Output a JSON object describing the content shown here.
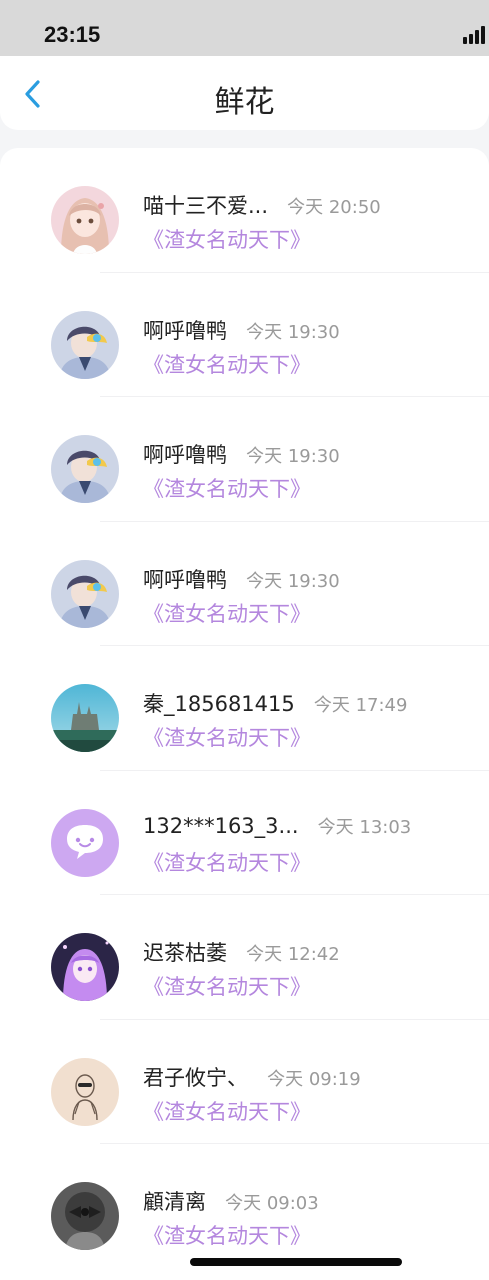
{
  "status_bar": {
    "time": "23:15",
    "signal_icon": "signal-bars-icon"
  },
  "header": {
    "title": "鲜花",
    "back_icon": "chevron-left-icon"
  },
  "colors": {
    "accent": "#b487de",
    "back_arrow": "#2a9de0",
    "timestamp": "#9a9a9a"
  },
  "items": [
    {
      "username": "喵十三不爱...",
      "time": "今天 20:50",
      "book": "《渣女名动天下》",
      "avatar": "anime-girl-avatar"
    },
    {
      "username": "啊呼噜鸭",
      "time": "今天 19:30",
      "book": "《渣女名动天下》",
      "avatar": "anime-boy-avatar"
    },
    {
      "username": "啊呼噜鸭",
      "time": "今天 19:30",
      "book": "《渣女名动天下》",
      "avatar": "anime-boy-avatar"
    },
    {
      "username": "啊呼噜鸭",
      "time": "今天 19:30",
      "book": "《渣女名动天下》",
      "avatar": "anime-boy-avatar"
    },
    {
      "username": "秦_185681415",
      "time": "今天 17:49",
      "book": "《渣女名动天下》",
      "avatar": "castle-avatar"
    },
    {
      "username": "132***163_3...",
      "time": "今天 13:03",
      "book": "《渣女名动天下》",
      "avatar": "chat-bubble-avatar"
    },
    {
      "username": "迟茶枯萎",
      "time": "今天 12:42",
      "book": "《渣女名动天下》",
      "avatar": "purple-hair-avatar"
    },
    {
      "username": "君子攸宁、",
      "time": "今天 09:19",
      "book": "《渣女名动天下》",
      "avatar": "sketch-avatar"
    },
    {
      "username": "顧清离",
      "time": "今天 09:03",
      "book": "《渣女名动天下》",
      "avatar": "ribbon-avatar"
    }
  ]
}
